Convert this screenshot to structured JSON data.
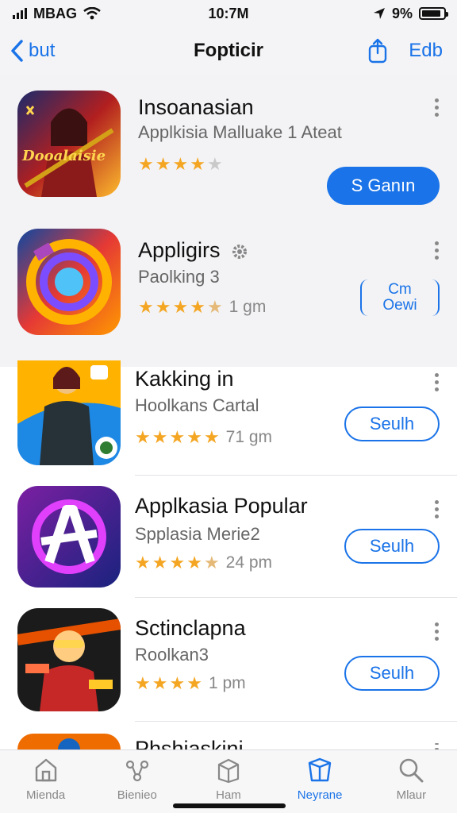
{
  "status_bar": {
    "carrier": "MBAG",
    "time": "10:7M",
    "battery": "9%",
    "battery_level": 0.9
  },
  "nav": {
    "back_label": "but",
    "title": "Fopticir",
    "edit_label": "Edb"
  },
  "apps": [
    {
      "name": "Insoanasian",
      "subtitle": "Applkisia Malluake 1 Ateat",
      "rating_text": "",
      "action": "S Ganın",
      "icon_text": "Dooalaisie",
      "stars": 4
    },
    {
      "name": "Appligirs",
      "subtitle": "Paolking 3",
      "rating_text": "1 gm",
      "action_line1": "Cm",
      "action_line2": "Oewi",
      "stars": 4.5
    },
    {
      "name": "Kakking in",
      "subtitle": "Hoolkans Cartal",
      "rating_text": "71 gm",
      "action": "Seulh",
      "stars": 5
    },
    {
      "name": "Applkasia Popular",
      "subtitle": "Spplasia Merie2",
      "rating_text": "24 pm",
      "action": "Seulh",
      "stars": 4.5
    },
    {
      "name": "Sctinclapna",
      "subtitle": "Roolkan3",
      "rating_text": "1 pm",
      "action": "Seulh",
      "stars": 4
    },
    {
      "name": "Phshiaskini",
      "subtitle": "",
      "rating_text": "",
      "action": "",
      "stars": 0
    }
  ],
  "tabs": [
    {
      "label": "Mienda",
      "icon": "home-icon"
    },
    {
      "label": "Bienieo",
      "icon": "nodes-icon"
    },
    {
      "label": "Ham",
      "icon": "box-icon"
    },
    {
      "label": "Neyrane",
      "icon": "cube-icon"
    },
    {
      "label": "Mlaur",
      "icon": "search-icon"
    }
  ],
  "colors": {
    "accent": "#1a73e8",
    "star": "#f4a623"
  }
}
